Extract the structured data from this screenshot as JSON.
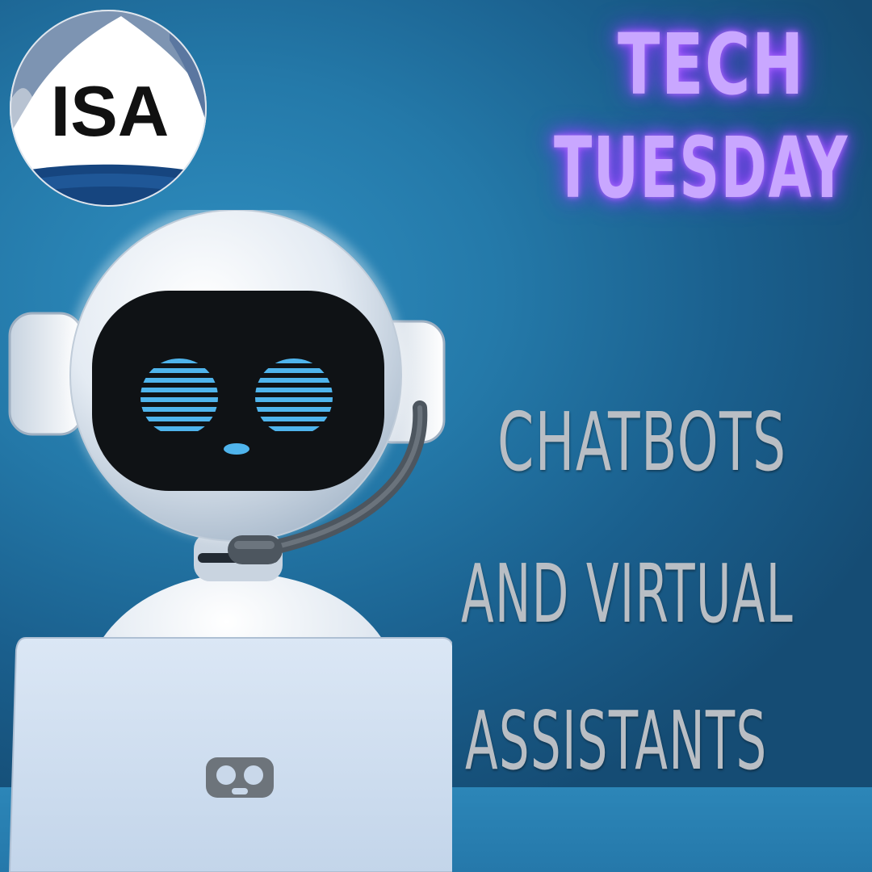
{
  "logo": {
    "text": "ISA",
    "colors": {
      "circle": "#ffffff",
      "navy": "#16457f",
      "slate": "#6e88a8",
      "text": "#111111"
    }
  },
  "headline": {
    "line1": "TECH",
    "line2": "TUESDAY",
    "color": "#c9a7ff",
    "glow": "#9a4cff"
  },
  "topic": {
    "line1": "CHATBOTS",
    "line2": "AND VIRTUAL",
    "line3": "ASSISTANTS",
    "color": "#b9bec4"
  },
  "illustration": {
    "subject": "robot-with-headset-at-laptop",
    "eye_color": "#4fb4ec",
    "visor_color": "#111111"
  },
  "background": {
    "color": "#2479a9"
  }
}
